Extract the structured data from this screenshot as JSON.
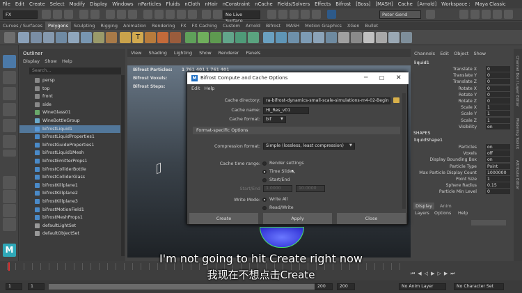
{
  "menubar": [
    "File",
    "Edit",
    "Create",
    "Select",
    "Modify",
    "Display",
    "Windows",
    "nParticles",
    "Fluids",
    "nCloth",
    "nHair",
    "nConstraint",
    "nCache",
    "Fields/Solvers",
    "Effects",
    "Bifrost",
    "[Boss]",
    "[MASH]",
    "Cache",
    "[Arnold]",
    "Workspace :",
    "Maya Classic"
  ],
  "status": {
    "mode": "FX",
    "live": "No Live Surface",
    "user": "Peter Gend"
  },
  "shelf_tabs": [
    "Curves / Surfaces",
    "Polygons",
    "Sculpting",
    "Rigging",
    "Animation",
    "Rendering",
    "FX",
    "FX Caching",
    "Custom",
    "Arnold",
    "Bifrost",
    "MASH",
    "Motion Graphics",
    "XGen",
    "Bullet"
  ],
  "outliner": {
    "title": "Outliner",
    "menu": [
      "Display",
      "Show",
      "Help"
    ],
    "search": "Search...",
    "items": [
      "persp",
      "top",
      "front",
      "side",
      "WineGlass01",
      "WineBottleGroup",
      "bifrostLiquid1",
      "bifrostLiquidProperties1",
      "bifrostGuideProperties1",
      "bifrostLiquid1Mesh",
      "bifrostEmitterProps1",
      "bifrostColliderBottle",
      "bifrostColliderGlass",
      "bifrostKillplane1",
      "bifrostKillplane2",
      "bifrostKillplane3",
      "bifrostMotionField1",
      "bifrostMeshProps1",
      "defaultLightSet",
      "defaultObjectSet"
    ]
  },
  "viewport": {
    "menu": [
      "View",
      "Shading",
      "Lighting",
      "Show",
      "Renderer",
      "Panels"
    ],
    "hud": {
      "particles_label": "Bifrost Particles:",
      "particles_v1": "1 761 401",
      "particles_v2": "1 761 401",
      "voxels_label": "Bifrost Voxels:",
      "steps_label": "Bifrost Steps:"
    }
  },
  "dialog": {
    "title": "Bifrost Compute and Cache Options",
    "menu": [
      "Edit",
      "Help"
    ],
    "cache_dir_label": "Cache directory:",
    "cache_dir": "ra-bifrost-dynamics-small-scale-simulations-m4-02-Begin",
    "cache_name_label": "Cache name:",
    "cache_name": "Hi_Res_v01",
    "cache_format_label": "Cache format:",
    "cache_format": "bif",
    "section": "Format-specific Options",
    "compression_label": "Compression format:",
    "compression": "Simple (lossless, least compression)",
    "time_range_label": "Cache time range:",
    "time_options": [
      "Render settings",
      "Time Slider",
      "Start/End"
    ],
    "start_end_label": "Start/End",
    "start": "1.0000",
    "end": "10.0000",
    "write_mode_label": "Write Mode:",
    "write_options": [
      "Write All",
      "Read/Write"
    ],
    "buttons": [
      "Create",
      "Apply",
      "Close"
    ]
  },
  "channel": {
    "menu": [
      "Channels",
      "Edit",
      "Object",
      "Show"
    ],
    "node": "liquid1",
    "attrs": [
      [
        "Translate X",
        "0"
      ],
      [
        "Translate Y",
        "0"
      ],
      [
        "Translate Z",
        "0"
      ],
      [
        "Rotate X",
        "0"
      ],
      [
        "Rotate Y",
        "0"
      ],
      [
        "Rotate Z",
        "0"
      ],
      [
        "Scale X",
        "1"
      ],
      [
        "Scale Y",
        "1"
      ],
      [
        "Scale Z",
        "1"
      ],
      [
        "Visibility",
        "on"
      ]
    ],
    "shapes_label": "SHAPES",
    "shape": "liquidShape1",
    "shape_attrs": [
      [
        "Particles",
        "on"
      ],
      [
        "Voxels",
        "off"
      ],
      [
        "Display Bounding Box",
        "on"
      ],
      [
        "Particle Type",
        "Point"
      ],
      [
        "Max Particle Display Count",
        "1000000"
      ],
      [
        "Point Size",
        "1"
      ],
      [
        "Sphere Radius",
        "0.15"
      ],
      [
        "Particle Min Level",
        "0"
      ]
    ],
    "tabs": [
      "Display",
      "Anim"
    ],
    "sub_menu": [
      "Layers",
      "Options",
      "Help"
    ]
  },
  "side_tabs": [
    "Channel Box / Layer Editor",
    "Modeling Toolkit",
    "Attribute Editor"
  ],
  "bottom": {
    "frame_start": "1",
    "frame_a": "1",
    "frame_b": "200",
    "frame_c": "200",
    "anim_layer": "No Anim Layer",
    "char_set": "No Character Set"
  },
  "subtitles": {
    "en": "I'm not going to hit Create right now",
    "zh": "我现在不想点击Create"
  },
  "colors": {
    "accent": "#52779a",
    "dialog_icon": "#1e6fc4"
  }
}
